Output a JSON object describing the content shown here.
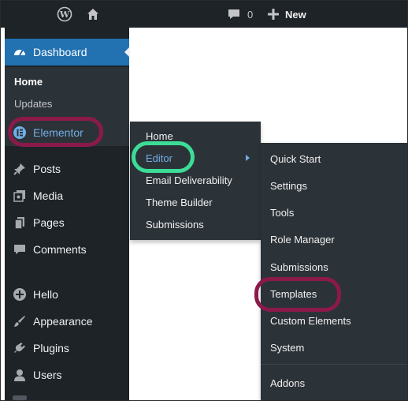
{
  "admin_bar": {
    "wp_logo_icon": "wordpress-logo-icon",
    "home_icon": "home-icon",
    "comments_count": "0",
    "new_label": "New"
  },
  "sidebar": {
    "dashboard": "Dashboard",
    "dashboard_sub": [
      "Home",
      "Updates"
    ],
    "items": [
      {
        "label": "Elementor",
        "icon": "elementor-icon"
      },
      {
        "label": "Posts",
        "icon": "pin-icon"
      },
      {
        "label": "Media",
        "icon": "media-icon"
      },
      {
        "label": "Pages",
        "icon": "pages-icon"
      },
      {
        "label": "Comments",
        "icon": "comment-icon"
      },
      {
        "label": "Hello",
        "icon": "plus-circle-icon"
      },
      {
        "label": "Appearance",
        "icon": "brush-icon"
      },
      {
        "label": "Plugins",
        "icon": "plug-icon"
      },
      {
        "label": "Users",
        "icon": "user-icon"
      }
    ]
  },
  "flyout_elementor": {
    "items": [
      "Home",
      "Editor",
      "Email Deliverability",
      "Theme Builder",
      "Submissions"
    ],
    "active": "Editor"
  },
  "flyout_editor": {
    "items": [
      "Quick Start",
      "Settings",
      "Tools",
      "Role Manager",
      "Submissions",
      "Templates",
      "Custom Elements",
      "System",
      "Addons"
    ]
  },
  "colors": {
    "sidebar_bg": "#1d2327",
    "submenu_bg": "#2c3338",
    "accent_blue": "#2271b1",
    "link_blue": "#72aee6",
    "highlight_maroon": "#8b1a4a",
    "highlight_green": "#3ddc97"
  }
}
